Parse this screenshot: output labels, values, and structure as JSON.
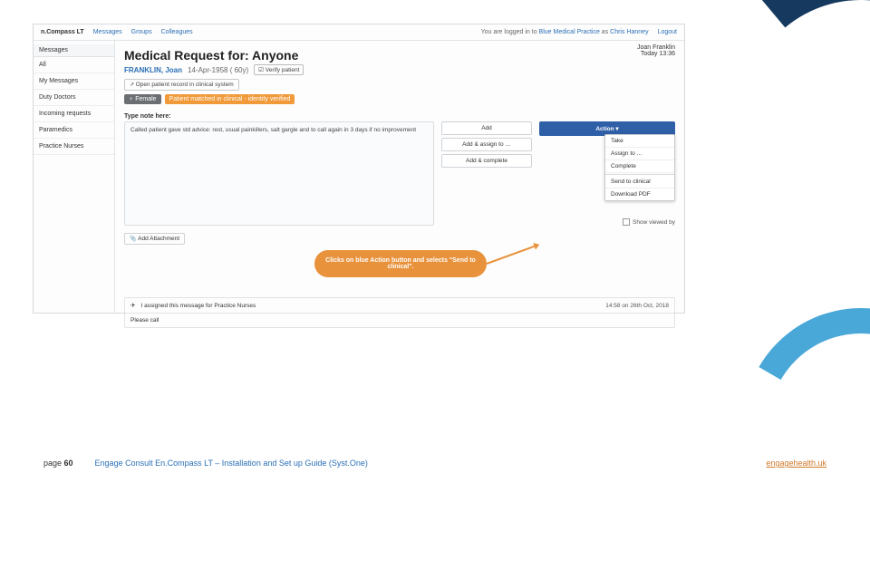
{
  "topbar": {
    "brand": "n.Compass LT",
    "nav": [
      "Messages",
      "Groups",
      "Colleagues"
    ],
    "login_prefix": "You are logged in to ",
    "practice": "Blue Medical Practice",
    "login_mid": " as ",
    "user": "Chris Hanney",
    "logout": "Logout"
  },
  "sidebar": {
    "header": "Messages",
    "items": [
      "All",
      "My Messages",
      "Duty Doctors",
      "Incoming requests",
      "Paramedics",
      "Practice Nurses"
    ]
  },
  "corner": {
    "name": "Joan Franklin",
    "time": "Today 13:36"
  },
  "page": {
    "title": "Medical Request for: Anyone",
    "patient_name": "FRANKLIN, Joan",
    "dob": "14-Apr-1958 ( 60y)",
    "verify_label": "Verify patient",
    "open_record": "Open patient record in clinical system",
    "badges": {
      "sex": "Female",
      "match": "Patient matched in clinical - identity verified"
    },
    "note_label": "Type note here:",
    "note_text": "Called patient gave std advice: rest, usual painkillers, salt gargle and to call again in 3 days if no improvement",
    "add_buttons": [
      "Add",
      "Add & assign to …",
      "Add & complete"
    ],
    "action_button": "Action ▾",
    "action_menu": [
      "Take",
      "Assign to …",
      "Complete",
      "Send to clinical",
      "Download PDF"
    ],
    "show_viewed": "Show viewed by",
    "attach": "Add Attachment",
    "bubble": "Clicks on blue Action button and selects \"Send to clinical\".",
    "log_text": "I assigned this message for Practice Nurses",
    "log_time": "14:58 on 26th Oct, 2018",
    "log_sub": "Please call"
  },
  "footer": {
    "page_label": "page ",
    "page_num": "60",
    "doc_title": "Engage Consult En.Compass LT – Installation and Set up Guide (Syst.One)",
    "site": "engagehealth.uk"
  }
}
